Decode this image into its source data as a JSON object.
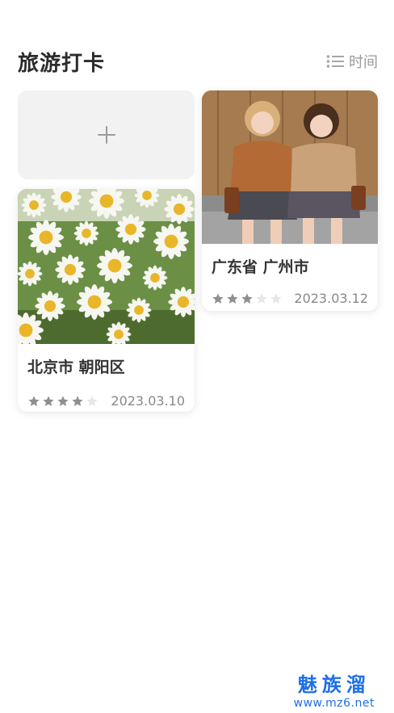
{
  "header": {
    "title": "旅游打卡",
    "sort_label": "时间",
    "sort_icon": "list-icon"
  },
  "add_card": {
    "icon": "plus-icon"
  },
  "cards": [
    {
      "location": "北京市 朝阳区",
      "rating": 4,
      "rating_max": 5,
      "date": "2023.03.10",
      "photo": "daisy-flowers-photo"
    },
    {
      "location": "广东省 广州市",
      "rating": 3,
      "rating_max": 5,
      "date": "2023.03.12",
      "photo": "two-girls-photo"
    }
  ],
  "colors": {
    "star_filled": "#8f8f8f",
    "star_empty": "#e6e6e6",
    "watermark": "#1d6fe8"
  },
  "watermark": {
    "line1": "魅族溜",
    "line2": "www.mz6.net"
  }
}
